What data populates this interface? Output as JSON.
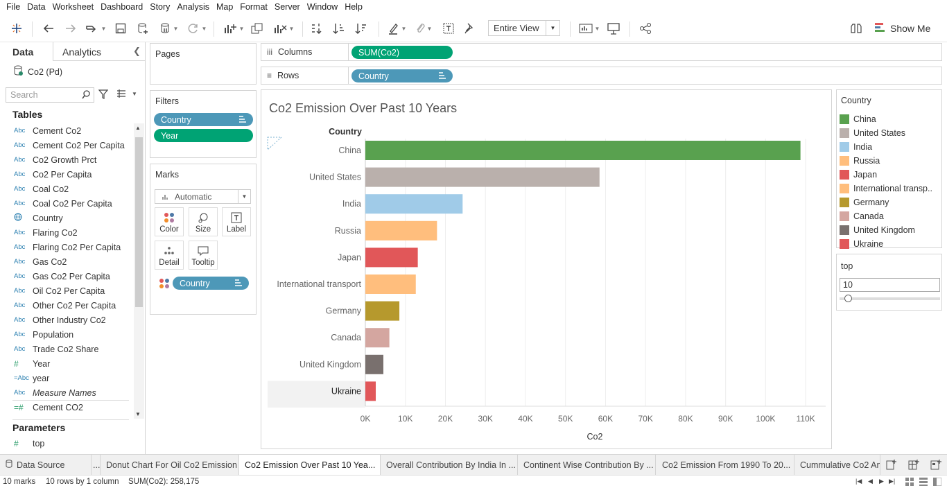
{
  "menu": [
    "File",
    "Data",
    "Worksheet",
    "Dashboard",
    "Story",
    "Analysis",
    "Map",
    "Format",
    "Server",
    "Window",
    "Help"
  ],
  "toolbar": {
    "fit_mode": "Entire View",
    "show_me": "Show Me"
  },
  "left_pane": {
    "tab_data": "Data",
    "tab_analytics": "Analytics",
    "datasource": "Co2  (Pd)",
    "search_placeholder": "Search",
    "tables_heading": "Tables",
    "fields": [
      {
        "type": "Abc",
        "name": "Cement Co2"
      },
      {
        "type": "Abc",
        "name": "Cement Co2 Per Capita"
      },
      {
        "type": "Abc",
        "name": "Co2 Growth Prct"
      },
      {
        "type": "Abc",
        "name": "Co2 Per Capita"
      },
      {
        "type": "Abc",
        "name": "Coal Co2"
      },
      {
        "type": "Abc",
        "name": "Coal Co2 Per Capita"
      },
      {
        "type": "globe",
        "name": "Country"
      },
      {
        "type": "Abc",
        "name": "Flaring Co2"
      },
      {
        "type": "Abc",
        "name": "Flaring Co2 Per Capita"
      },
      {
        "type": "Abc",
        "name": "Gas Co2"
      },
      {
        "type": "Abc",
        "name": "Gas Co2 Per Capita"
      },
      {
        "type": "Abc",
        "name": "Oil Co2 Per Capita"
      },
      {
        "type": "Abc",
        "name": "Other Co2 Per Capita"
      },
      {
        "type": "Abc",
        "name": "Other Industry Co2"
      },
      {
        "type": "Abc",
        "name": "Population"
      },
      {
        "type": "Abc",
        "name": "Trade Co2 Share"
      },
      {
        "type": "#",
        "name": "Year"
      },
      {
        "type": "=Abc",
        "name": "year"
      },
      {
        "type": "Abc",
        "name": "Measure Names",
        "italic": true
      },
      {
        "type": "=#",
        "name": "Cement CO2"
      }
    ],
    "parameters_heading": "Parameters",
    "parameter_top": {
      "type": "#",
      "name": "top"
    }
  },
  "cards": {
    "pages": "Pages",
    "filters": "Filters",
    "filter_pills": [
      "Country",
      "Year"
    ],
    "marks": "Marks",
    "mark_type": "Automatic",
    "mark_buttons": [
      "Color",
      "Size",
      "Label",
      "Detail",
      "Tooltip"
    ],
    "mark_pill": "Country"
  },
  "shelves": {
    "columns_label": "Columns",
    "columns_pill": "SUM(Co2)",
    "rows_label": "Rows",
    "rows_pill": "Country"
  },
  "viz": {
    "title": "Co2 Emission Over Past 10 Years",
    "row_header": "Country"
  },
  "chart_data": {
    "type": "bar",
    "orientation": "horizontal",
    "title": "Co2 Emission Over Past 10 Years",
    "xlabel": "Co2",
    "ylabel": "Country",
    "xlim": [
      0,
      115000
    ],
    "x_ticks": [
      "0K",
      "10K",
      "20K",
      "30K",
      "40K",
      "50K",
      "60K",
      "70K",
      "80K",
      "90K",
      "100K",
      "110K"
    ],
    "grid": true,
    "categories": [
      "China",
      "United States",
      "India",
      "Russia",
      "Japan",
      "International transport",
      "Germany",
      "Canada",
      "United Kingdom",
      "Ukraine"
    ],
    "values": [
      108700,
      58500,
      24300,
      17900,
      13100,
      12600,
      8500,
      6000,
      4500,
      2600
    ],
    "colors": [
      "#59a14f",
      "#bab0ac",
      "#a0cbe8",
      "#ffbe7d",
      "#e15759",
      "#ffbe7d",
      "#b6992d",
      "#d4a6a0",
      "#79706e",
      "#e15759"
    ]
  },
  "legend": {
    "title": "Country",
    "items": [
      {
        "label": "China",
        "color": "#59a14f"
      },
      {
        "label": "United States",
        "color": "#bab0ac"
      },
      {
        "label": "India",
        "color": "#a0cbe8"
      },
      {
        "label": "Russia",
        "color": "#ffbe7d"
      },
      {
        "label": "Japan",
        "color": "#e15759"
      },
      {
        "label": "International transp..",
        "color": "#ffbe7d"
      },
      {
        "label": "Germany",
        "color": "#b6992d"
      },
      {
        "label": "Canada",
        "color": "#d4a6a0"
      },
      {
        "label": "United Kingdom",
        "color": "#79706e"
      },
      {
        "label": "Ukraine",
        "color": "#e15759"
      }
    ]
  },
  "parameter_card": {
    "title": "top",
    "value": "10",
    "slider_fraction": 0.05
  },
  "sheet_tabs": [
    {
      "label": "Data Source",
      "active": false
    },
    {
      "label": "...",
      "active": false
    },
    {
      "label": "Donut Chart For Oil Co2 Emission",
      "active": false
    },
    {
      "label": "Co2 Emission Over Past 10 Yea...",
      "active": true
    },
    {
      "label": "Overall Contribution By India In ...",
      "active": false
    },
    {
      "label": "Continent Wise Contribution By ...",
      "active": false
    },
    {
      "label": "Co2 Emission From 1990 To 20...",
      "active": false
    },
    {
      "label": "Cummulative Co2 An",
      "active": false
    }
  ],
  "status": {
    "marks": "10 marks",
    "rows": "10 rows by 1 column",
    "sum": "SUM(Co2): 258,175"
  }
}
